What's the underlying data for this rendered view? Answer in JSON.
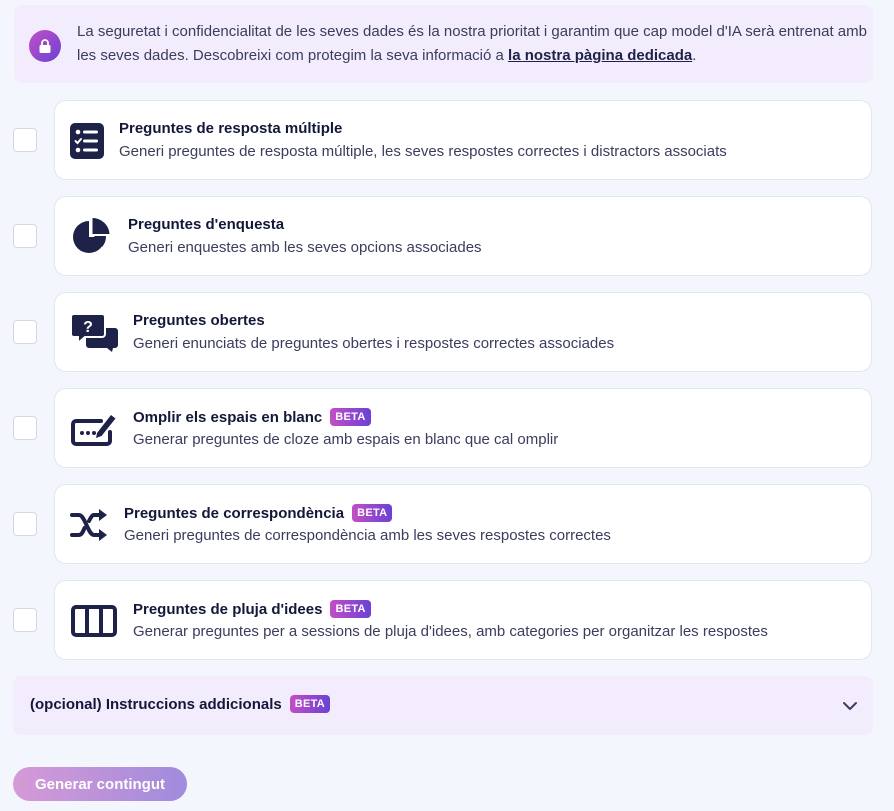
{
  "notice": {
    "text": "La seguretat i confidencialitat de les seves dades és la nostra prioritat i garantim que cap model d'IA serà entrenat amb les seves dades. Descobreixi com protegim la seva informació a ",
    "link": "la nostra pàgina dedicada",
    "suffix": ".",
    "icon": "lock-icon"
  },
  "options": [
    {
      "title": "Preguntes de resposta múltiple",
      "description": "Generi preguntes de resposta múltiple, les seves respostes correctes i distractors associats",
      "icon": "checklist-icon",
      "beta": "",
      "checked": false
    },
    {
      "title": "Preguntes d'enquesta",
      "description": "Generi enquestes amb les seves opcions associades",
      "icon": "pie-chart-icon",
      "beta": "",
      "checked": false
    },
    {
      "title": "Preguntes obertes",
      "description": "Generi enunciats de preguntes obertes i respostes correctes associades",
      "icon": "question-chat-icon",
      "beta": "",
      "checked": false
    },
    {
      "title": "Omplir els espais en blanc",
      "description": "Generar preguntes de cloze amb espais en blanc que cal omplir",
      "icon": "fill-blank-pencil-icon",
      "beta": "BETA",
      "checked": false
    },
    {
      "title": "Preguntes de correspondència",
      "description": "Generi preguntes de correspondència amb les seves respostes correctes",
      "icon": "shuffle-icon",
      "beta": "BETA",
      "checked": false
    },
    {
      "title": "Preguntes de pluja d'idees",
      "description": "Generar preguntes per a sessions de pluja d'idees, amb categories per organitzar les respostes",
      "icon": "columns-icon",
      "beta": "BETA",
      "checked": false
    }
  ],
  "instructions": {
    "label": "(opcional) Instruccions addicionals",
    "beta": "BETA",
    "icon": "chevron-down-icon"
  },
  "generate_button": "Generar contingut",
  "colors": {
    "accent_start": "#c24fc4",
    "accent_end": "#6a42d4",
    "icon_navy": "#1e2248",
    "panel_bg": "#f3ecfd"
  }
}
